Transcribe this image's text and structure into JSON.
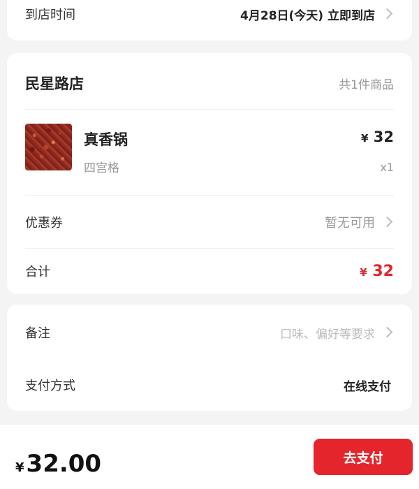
{
  "arrival": {
    "label": "到店时间",
    "value": "4月28日(今天) 立即到店"
  },
  "store": {
    "name": "民星路店",
    "item_count": "共1件商品"
  },
  "item": {
    "name": "真香锅",
    "spec": "四宫格",
    "currency": "¥",
    "price": "32",
    "quantity": "x1"
  },
  "coupon": {
    "label": "优惠券",
    "value": "暂无可用"
  },
  "total": {
    "label": "合计",
    "currency": "¥",
    "amount": "32"
  },
  "remark": {
    "label": "备注",
    "placeholder": "口味、偏好等要求"
  },
  "payment": {
    "label": "支付方式",
    "value": "在线支付"
  },
  "bottom_bar": {
    "currency": "¥",
    "amount": "32.00",
    "pay_button_label": "去支付"
  },
  "colors": {
    "accent": "#e4252b",
    "page_background": "#f4f4f4"
  }
}
